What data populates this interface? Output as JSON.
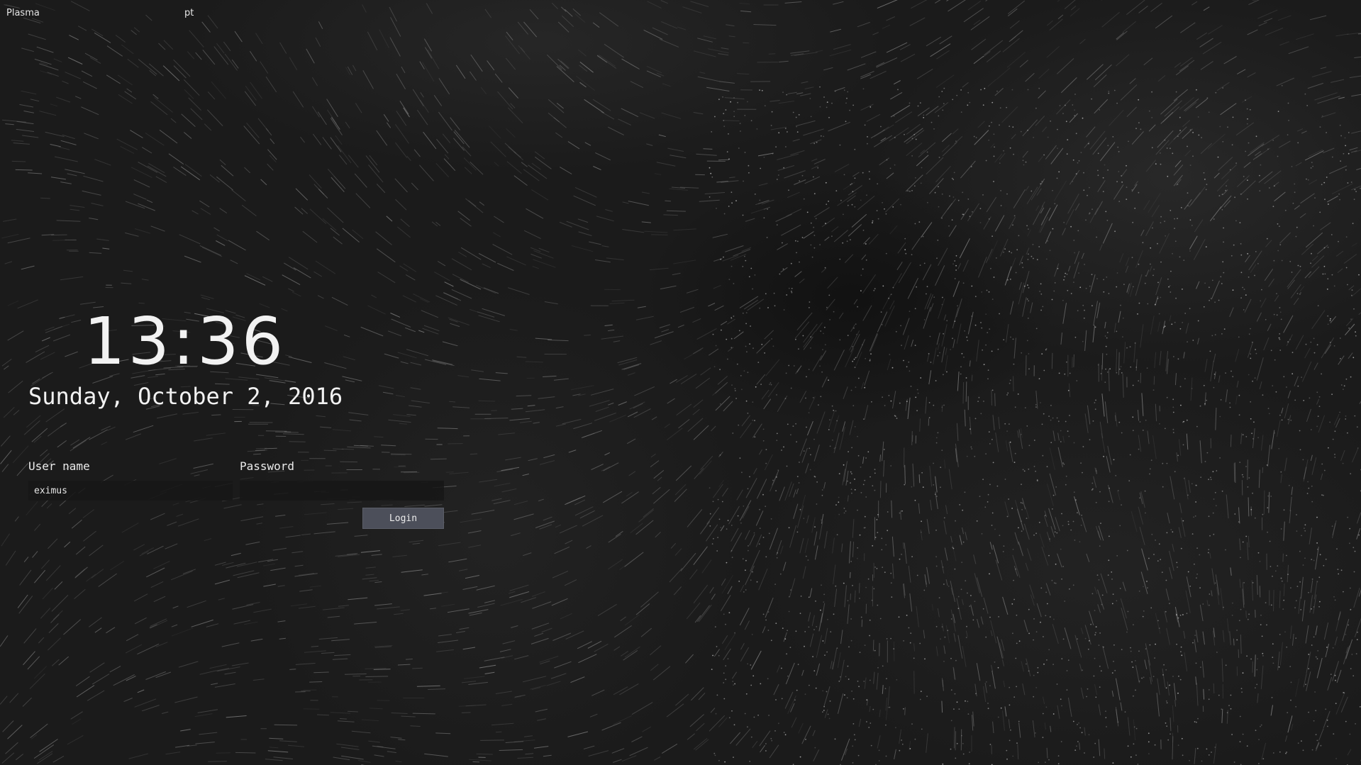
{
  "top_bar": {
    "session": "Plasma",
    "keyboard_layout": "pt"
  },
  "clock": {
    "time": "13:36",
    "date": "Sunday, October 2, 2016"
  },
  "login_form": {
    "username_label": "User name",
    "username_value": "eximus",
    "password_label": "Password",
    "password_value": "",
    "login_button": "Login"
  },
  "colors": {
    "background": "#1b1b1b",
    "text": "#f2f2f2",
    "button": "#4c4f5a"
  }
}
